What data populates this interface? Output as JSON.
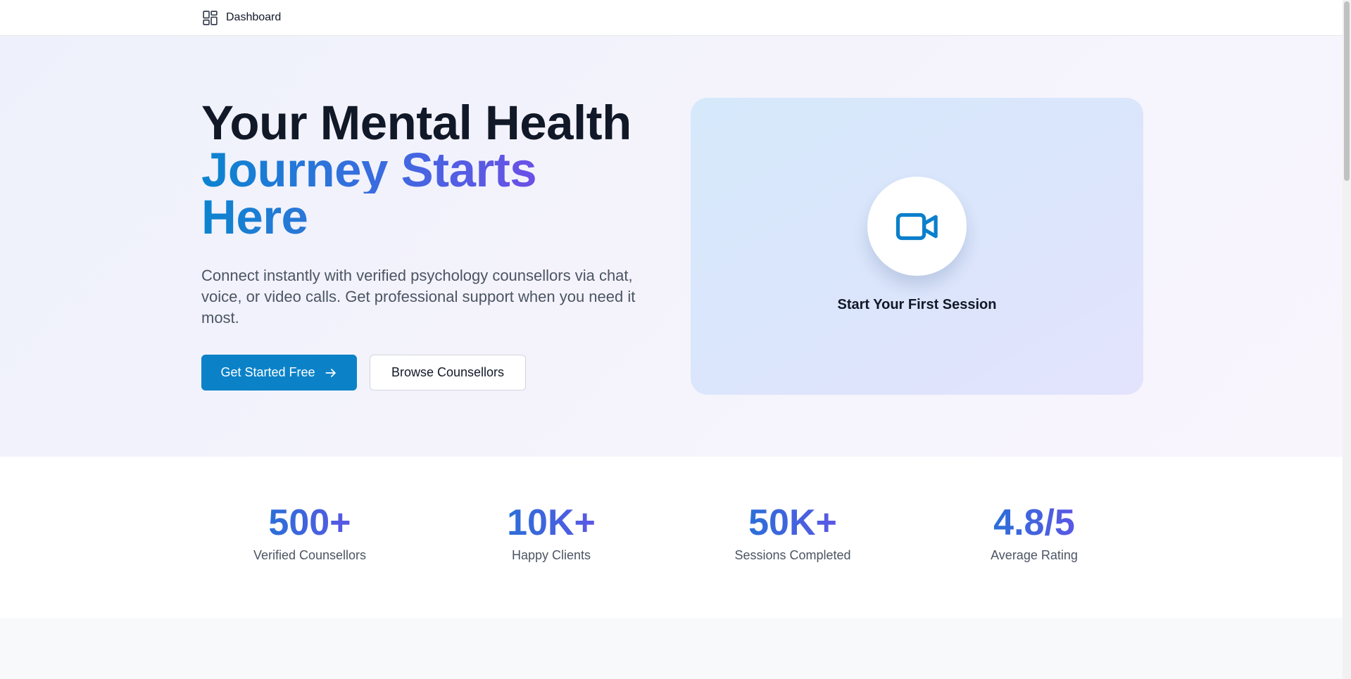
{
  "nav": {
    "dashboard_label": "Dashboard",
    "dashboard_icon": "dashboard-grid-icon"
  },
  "hero": {
    "title_line1": "Your Mental Health",
    "title_line2": "Journey Starts",
    "title_line3": "Here",
    "subtitle": "Connect instantly with verified psychology counsellors via chat, voice, or video calls. Get professional support when you need it most.",
    "primary_button": "Get Started Free",
    "primary_button_icon": "arrow-right-icon",
    "secondary_button": "Browse Counsellors",
    "card_icon": "video-camera-icon",
    "card_label": "Start Your First Session"
  },
  "stats": [
    {
      "value": "500+",
      "label": "Verified Counsellors"
    },
    {
      "value": "10K+",
      "label": "Happy Clients"
    },
    {
      "value": "50K+",
      "label": "Sessions Completed"
    },
    {
      "value": "4.8/5",
      "label": "Average Rating"
    }
  ],
  "colors": {
    "primary": "#0b82c8",
    "accent_purple": "#6a4fe6",
    "heading": "#111827",
    "muted_text": "#4b5563"
  }
}
